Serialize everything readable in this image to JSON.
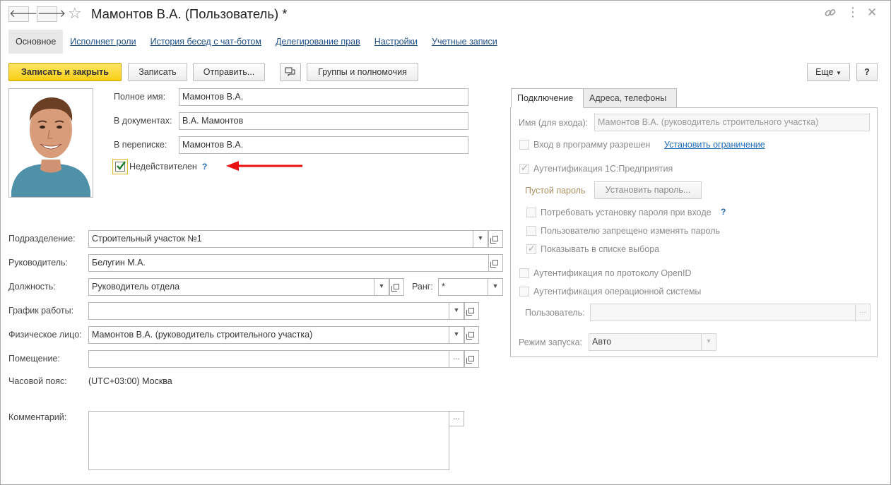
{
  "window": {
    "title": "Мамонтов В.А. (Пользователь) *",
    "nav_back": "🡐",
    "nav_forward": "🡒"
  },
  "tabs_top": [
    {
      "label": "Основное"
    },
    {
      "label": "Исполняет роли"
    },
    {
      "label": "История бесед с чат-ботом"
    },
    {
      "label": "Делегирование прав"
    },
    {
      "label": "Настройки"
    },
    {
      "label": "Учетные записи"
    }
  ],
  "toolbar": {
    "save_close": "Записать и закрыть",
    "save": "Записать",
    "send": "Отправить...",
    "groups": "Группы и полномочия",
    "more": "Еще",
    "help": "?"
  },
  "identity": {
    "full_name_label": "Полное имя:",
    "full_name_value": "Мамонтов В.А.",
    "in_docs_label": "В документах:",
    "in_docs_value": "В.А. Мамонтов",
    "in_corr_label": "В переписке:",
    "in_corr_value": "Мамонтов В.А.",
    "invalid_label": "Недействителен",
    "invalid_checked": true,
    "invalid_hint": "?"
  },
  "details": {
    "division_label": "Подразделение:",
    "division_value": "Строительный участок №1",
    "manager_label": "Руководитель:",
    "manager_value": "Белугин М.А.",
    "position_label": "Должность:",
    "position_value": "Руководитель отдела",
    "rank_label": "Ранг:",
    "rank_value": "*",
    "schedule_label": "График работы:",
    "schedule_value": "",
    "person_label": "Физическое лицо:",
    "person_value": "Мамонтов В.А. (руководитель строительного участка)",
    "room_label": "Помещение:",
    "room_value": "",
    "timezone_label": "Часовой пояс:",
    "timezone_value": "(UTC+03:00) Москва",
    "comment_label": "Комментарий:",
    "comment_value": ""
  },
  "right_panel": {
    "tabs": [
      "Подключение",
      "Адреса, телефоны"
    ],
    "login_label": "Имя (для входа):",
    "login_value": "Мамонтов В.А. (руководитель строительного участка)",
    "login_allowed_label": "Вход в программу разрешен",
    "set_restriction_link": "Установить ограничение",
    "auth_1c_label": "Аутентификация 1С:Предприятия",
    "empty_password_label": "Пустой пароль",
    "set_password_button": "Установить пароль...",
    "require_pwd_change_label": "Потребовать установку пароля при входе",
    "require_pwd_hint": "?",
    "forbid_pwd_change_label": "Пользователю запрещено изменять пароль",
    "show_in_list_label": "Показывать в списке выбора",
    "auth_openid_label": "Аутентификация по протоколу OpenID",
    "auth_os_label": "Аутентификация операционной системы",
    "os_user_label": "Пользователь:",
    "os_user_value": "",
    "launch_mode_label": "Режим запуска:",
    "launch_mode_value": "Авто"
  },
  "colors": {
    "primary_button": "#f7cf16",
    "link": "#1e6ab7",
    "annotation_arrow": "#e81010",
    "checkbox_check": "#1a7d2c"
  }
}
